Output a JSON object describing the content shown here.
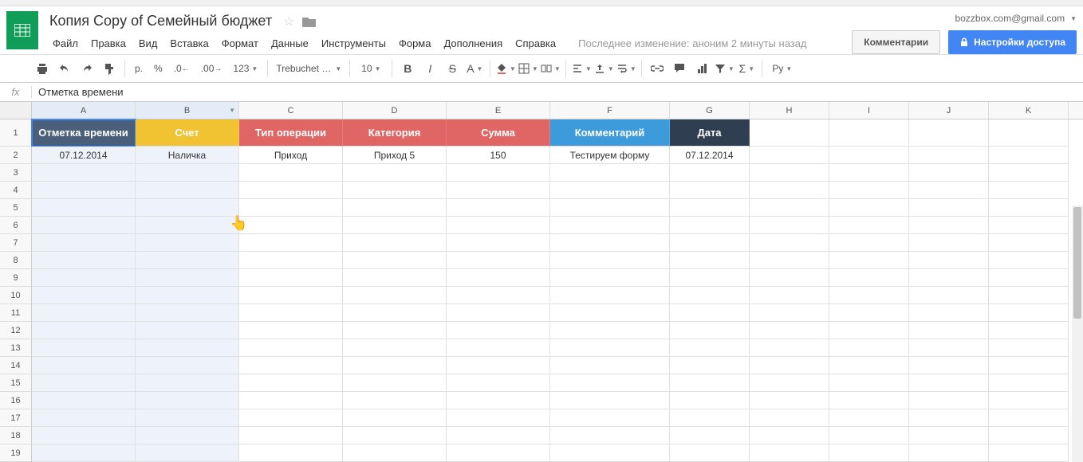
{
  "header": {
    "doc_title": "Копия Copy of Семейный бюджет",
    "user_email": "bozzbox.com@gmail.com",
    "comments_btn": "Комментарии",
    "share_btn": "Настройки доступа",
    "last_edit": "Последнее изменение: аноним 2 минуты назад"
  },
  "menu": {
    "file": "Файл",
    "edit": "Правка",
    "view": "Вид",
    "insert": "Вставка",
    "format": "Формат",
    "data": "Данные",
    "tools": "Инструменты",
    "form": "Форма",
    "addons": "Дополнения",
    "help": "Справка"
  },
  "toolbar": {
    "currency": "р.",
    "percent": "%",
    "dec_dec": ".0_",
    "dec_inc": ".00_",
    "more_fmt": "123",
    "font_name": "Trebuchet …",
    "font_size": "10",
    "lang": "Ру"
  },
  "formula_bar": {
    "fx": "fx",
    "value": "Отметка времени"
  },
  "columns": [
    "A",
    "B",
    "C",
    "D",
    "E",
    "F",
    "G",
    "H",
    "I",
    "J",
    "K"
  ],
  "table_headers": {
    "a": "Отметка времени",
    "b": "Счет",
    "c": "Тип операции",
    "d": "Категория",
    "e": "Сумма",
    "f": "Комментарий",
    "g": "Дата"
  },
  "data_row": {
    "a": "07.12.2014",
    "b": "Наличка",
    "c": "Приход",
    "d": "Приход 5",
    "e": "150",
    "f": "Тестируем форму",
    "g": "07.12.2014"
  },
  "row_numbers": [
    "1",
    "2",
    "3",
    "4",
    "5",
    "6",
    "7",
    "8",
    "9",
    "10",
    "11",
    "12",
    "13",
    "14",
    "15",
    "16",
    "17",
    "18",
    "19"
  ]
}
